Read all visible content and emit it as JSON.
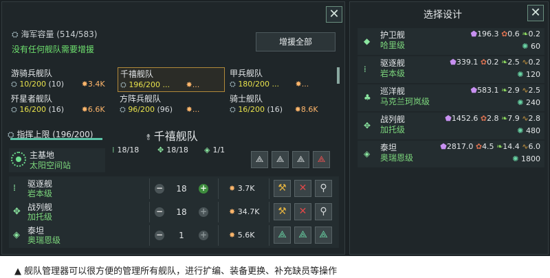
{
  "fleet_manager": {
    "naval_capacity_label": "海军容量 (514/583)",
    "no_reinforce_text": "没有任何舰队需要增援",
    "reinforce_all_label": "增援全部",
    "fleets": [
      {
        "name": "游骑兵舰队",
        "count": "10/200",
        "extra": "(10)",
        "power": "3.4K",
        "selected": false
      },
      {
        "name": "千禧舰队",
        "count": "196/200 ...",
        "extra": "",
        "power": "...",
        "selected": true
      },
      {
        "name": "甲兵舰队",
        "count": "180/200 ...",
        "extra": "",
        "power": "...",
        "selected": false
      },
      {
        "name": "歼星者舰队",
        "count": "16/200",
        "extra": "(16)",
        "power": "6.6K",
        "selected": false
      },
      {
        "name": "方阵兵舰队",
        "count": "96/200",
        "extra": "(96)",
        "power": "...",
        "selected": false
      },
      {
        "name": "骑士舰队",
        "count": "16/200",
        "extra": "(16)",
        "power": "8.6K",
        "selected": false
      }
    ],
    "command_limit_label": "指挥上限 (196/200)",
    "selected_fleet_title": "千禧舰队",
    "base": {
      "title": "主基地",
      "location": "太阳空间站"
    },
    "stats": [
      {
        "icon": "destroyer-icon",
        "value": "18/18"
      },
      {
        "icon": "battleship-icon",
        "value": "18/18"
      },
      {
        "icon": "titan-icon",
        "value": "1/1"
      }
    ],
    "ships": [
      {
        "type": "驱逐舰",
        "design": "岩本级",
        "qty": "18",
        "power": "3.7K",
        "plus_enabled": true
      },
      {
        "type": "战列舰",
        "design": "加托级",
        "qty": "18",
        "power": "34.7K",
        "plus_enabled": false
      },
      {
        "type": "泰坦",
        "design": "奥瑞恩级",
        "qty": "1",
        "power": "5.6K",
        "plus_enabled": false
      }
    ]
  },
  "design_panel": {
    "title": "选择设计",
    "designs": [
      {
        "type": "护卫舰",
        "name": "哈里级",
        "alloy": "196.3",
        "food": "0.6",
        "energy": "0.2",
        "power": "",
        "crew": "60"
      },
      {
        "type": "驱逐舰",
        "name": "岩本级",
        "alloy": "339.1",
        "food": "0.2",
        "energy": "2.5",
        "power": "0.2",
        "crew": "120"
      },
      {
        "type": "巡洋舰",
        "name": "马克兰珂岚级",
        "alloy": "583.1",
        "food": "",
        "energy": "2.9",
        "power": "2.5",
        "crew": "240"
      },
      {
        "type": "战列舰",
        "name": "加托级",
        "alloy": "1452.6",
        "food": "2.8",
        "energy": "7.9",
        "power": "2.8",
        "crew": "480"
      },
      {
        "type": "泰坦",
        "name": "奥瑞恩级",
        "alloy": "2817.0",
        "food": "4.5",
        "energy": "14.4",
        "power": "6.0",
        "crew": "1800"
      }
    ]
  },
  "caption": "▲ 舰队管理器可以很方便的管理所有舰队，进行扩编、装备更换、补充缺员等操作",
  "colors": {
    "accent_green": "#6ee06e",
    "selected_border": "#b28a3a",
    "panel_bg": "#1f2629"
  }
}
